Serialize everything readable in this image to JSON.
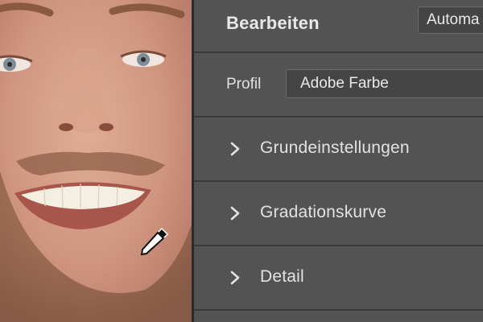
{
  "panel": {
    "title": "Bearbeiten",
    "mode_select_value": "Automa",
    "profile_label": "Profil",
    "profile_value": "Adobe Farbe",
    "sections": [
      {
        "label": "Grundeinstellungen",
        "icon": "chevron-right-icon"
      },
      {
        "label": "Gradationskurve",
        "icon": "chevron-right-icon"
      },
      {
        "label": "Detail",
        "icon": "chevron-right-icon"
      }
    ]
  },
  "preview": {
    "cursor_icon": "eyedropper-icon"
  },
  "colors": {
    "panel_bg": "#535353",
    "separator": "#3a3a3a",
    "text": "#e2e2e2",
    "select_bg": "#454545"
  }
}
